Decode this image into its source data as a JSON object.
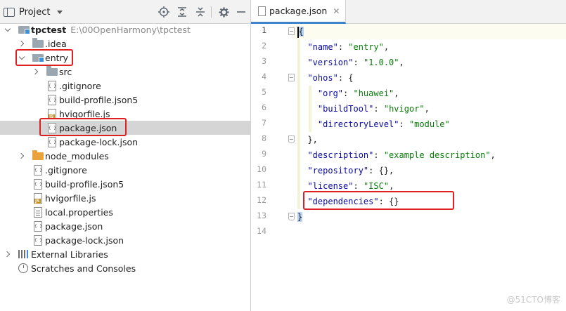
{
  "project_panel": {
    "title": "Project",
    "toolbar_icons": [
      "locate-icon",
      "expand-all-icon",
      "collapse-all-icon",
      "gear-icon",
      "minimize-icon"
    ],
    "tree": [
      {
        "label": "tpctest",
        "hint": "E:\\00OpenHarmony\\tpctest",
        "icon": "module-folder-icon",
        "expanded": true
      },
      {
        "label": ".idea",
        "icon": "folder-icon",
        "expanded": false
      },
      {
        "label": "entry",
        "icon": "module-folder-icon",
        "expanded": true
      },
      {
        "label": "src",
        "icon": "folder-icon",
        "expanded": false
      },
      {
        "label": ".gitignore",
        "icon": "file-icon"
      },
      {
        "label": "build-profile.json5",
        "icon": "json-file-icon"
      },
      {
        "label": "hvigorfile.js",
        "icon": "js-file-icon"
      },
      {
        "label": "package.json",
        "icon": "json-file-icon",
        "selected": true
      },
      {
        "label": "package-lock.json",
        "icon": "json-file-icon"
      },
      {
        "label": "node_modules",
        "icon": "folder-icon",
        "expanded": false
      },
      {
        "label": ".gitignore",
        "icon": "file-icon"
      },
      {
        "label": "build-profile.json5",
        "icon": "json-file-icon"
      },
      {
        "label": "hvigorfile.js",
        "icon": "js-file-icon"
      },
      {
        "label": "local.properties",
        "icon": "properties-file-icon"
      },
      {
        "label": "package.json",
        "icon": "json-file-icon"
      },
      {
        "label": "package-lock.json",
        "icon": "json-file-icon"
      },
      {
        "label": "External Libraries",
        "icon": "library-icon",
        "expanded": false
      },
      {
        "label": "Scratches and Consoles",
        "icon": "scratch-icon"
      }
    ]
  },
  "editor": {
    "tab_label": "package.json",
    "line_numbers": [
      "1",
      "2",
      "3",
      "4",
      "5",
      "6",
      "7",
      "8",
      "9",
      "10",
      "11",
      "12",
      "13",
      "14"
    ],
    "lines": [
      "{",
      "  \"name\": \"entry\",",
      "  \"version\": \"1.0.0\",",
      "  \"ohos\": {",
      "    \"org\": \"huawei\",",
      "    \"buildTool\": \"hvigor\",",
      "    \"directoryLevel\": \"module\"",
      "  },",
      "  \"description\": \"example description\",",
      "  \"repository\": {},",
      "  \"license\": \"ISC\",",
      "  \"dependencies\": {}",
      "}",
      ""
    ],
    "tokens": {
      "name_key": "\"name\"",
      "name_val": "\"entry\"",
      "version_key": "\"version\"",
      "version_val": "\"1.0.0\"",
      "ohos_key": "\"ohos\"",
      "org_key": "\"org\"",
      "org_val": "\"huawei\"",
      "buildtool_key": "\"buildTool\"",
      "buildtool_val": "\"hvigor\"",
      "dirlevel_key": "\"directoryLevel\"",
      "dirlevel_val": "\"module\"",
      "desc_key": "\"description\"",
      "desc_val": "\"example description\"",
      "repo_key": "\"repository\"",
      "license_key": "\"license\"",
      "license_val": "\"ISC\"",
      "deps_key": "\"dependencies\""
    },
    "syntax_colors": {
      "key": "#0a0aa0",
      "string": "#0b7a0b",
      "brace_highlight": "#b7d3f0"
    }
  },
  "highlight_color": "#e02020",
  "watermark": "@51CTO博客"
}
